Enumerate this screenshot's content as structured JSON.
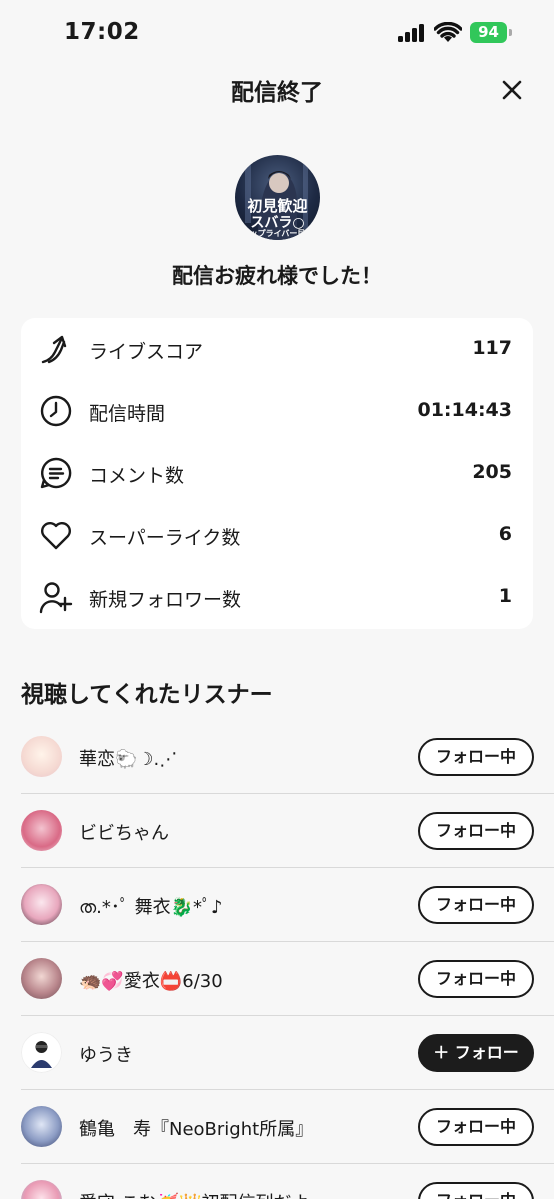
{
  "status_bar": {
    "time": "17:02",
    "battery": "94"
  },
  "header": {
    "title": "配信終了",
    "close_icon": "close-icon"
  },
  "streamer": {
    "avatar_text_1": "初見歓迎",
    "avatar_text_2": "スバラ○",
    "avatar_text_3": "トップライバー目指",
    "message": "配信お疲れ様でした！"
  },
  "stats": [
    {
      "icon": "arrow-up-icon",
      "label": "ライブスコア",
      "value": "117"
    },
    {
      "icon": "clock-icon",
      "label": "配信時間",
      "value": "01:14:43"
    },
    {
      "icon": "comment-icon",
      "label": "コメント数",
      "value": "205"
    },
    {
      "icon": "heart-icon",
      "label": "スーパーライク数",
      "value": "6"
    },
    {
      "icon": "add-user-icon",
      "label": "新規フォロワー数",
      "value": "1"
    }
  ],
  "listeners_section": {
    "title": "視聴してくれたリスナー",
    "items": [
      {
        "name": "華恋🐑☽.⋰",
        "button": "フォロー中",
        "following": true
      },
      {
        "name": "ビビちゃん",
        "button": "フォロー中",
        "following": true
      },
      {
        "name": "ത.*･ﾟ 舞衣🐉*ﾟ♪",
        "button": "フォロー中",
        "following": true
      },
      {
        "name": "🦔💞愛衣📛6/30",
        "button": "フォロー中",
        "following": true
      },
      {
        "name": "ゆうき",
        "button": "＋ フォロー",
        "following": false
      },
      {
        "name": "鶴亀　寿『NeoBright所属』",
        "button": "フォロー中",
        "following": true
      },
      {
        "name": "愛守 こむ🥳👑初配信列だよ",
        "button": "フォロー中",
        "following": true
      }
    ]
  },
  "colors": {
    "background": "#f7f7f7",
    "card": "#ffffff",
    "battery": "#31c75a",
    "text": "#1a1a1a"
  }
}
